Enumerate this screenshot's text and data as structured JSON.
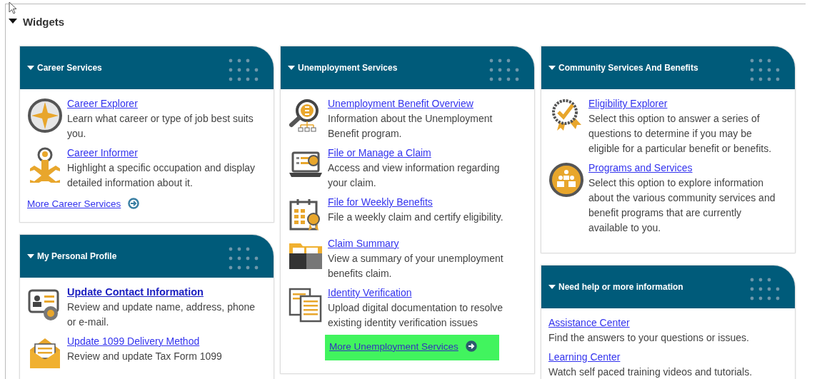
{
  "section": {
    "title": "Widgets",
    "expanded": true
  },
  "columns": [
    {
      "widgets": [
        {
          "title": "Career Services",
          "expanded": true,
          "items": [
            {
              "kind": "compass",
              "title": "Career Explorer",
              "bold": false,
              "description": "Learn what career or type of job best suits you."
            },
            {
              "kind": "person",
              "title": "Career Informer",
              "bold": false,
              "description": "Highlight a specific occupation and display detailed information about it."
            }
          ],
          "more": {
            "label": "More Career Services",
            "highlighted": false
          }
        },
        {
          "title": "My Personal Profile",
          "expanded": true,
          "items": [
            {
              "kind": "idcard",
              "title": "Update Contact Information",
              "bold": true,
              "description": "Review and update name, address, phone or e-mail."
            },
            {
              "kind": "envelope",
              "title": "Update 1099 Delivery Method",
              "bold": false,
              "description": "Review and update Tax Form 1099"
            }
          ]
        }
      ]
    },
    {
      "widgets": [
        {
          "title": "Unemployment Services",
          "expanded": true,
          "items": [
            {
              "kind": "magnifier",
              "title": "Unemployment Benefit Overview",
              "bold": false,
              "description": "Information about the Unemployment Benefit program."
            },
            {
              "kind": "laptop",
              "title": "File or Manage a Claim",
              "bold": false,
              "description": "Access and view information regarding your claim."
            },
            {
              "kind": "calendar",
              "title": "File for Weekly Benefits",
              "bold": false,
              "description": "File a weekly claim and certify eligibility."
            },
            {
              "kind": "folder",
              "title": "Claim Summary",
              "bold": false,
              "description": "View a summary of your unemployment benefits claim."
            },
            {
              "kind": "documents",
              "title": "Identity Verification",
              "bold": false,
              "description": "Upload digital documentation to resolve existing identity verification issues"
            }
          ],
          "more": {
            "label": "More Unemployment Services",
            "highlighted": true
          }
        }
      ]
    },
    {
      "widgets": [
        {
          "title": "Community Services And Benefits",
          "expanded": true,
          "items": [
            {
              "kind": "badge",
              "title": "Eligibility Explorer",
              "bold": false,
              "description": "Select this option to answer a series of questions to determine if you may be eligible for a particular benefit or benefits."
            },
            {
              "kind": "group",
              "title": "Programs and Services",
              "bold": false,
              "description": "Select this option to explore information about the various community services and benefit programs that are currently available to you."
            }
          ]
        },
        {
          "title": "Need help or more information",
          "expanded": true,
          "items": [
            {
              "kind": "text",
              "title": "Assistance Center",
              "bold": false,
              "description": "Find the answers to your questions or issues."
            },
            {
              "kind": "text",
              "title": "Learning Center",
              "bold": false,
              "description": "Watch self paced training videos and tutorials."
            }
          ]
        }
      ]
    }
  ]
}
